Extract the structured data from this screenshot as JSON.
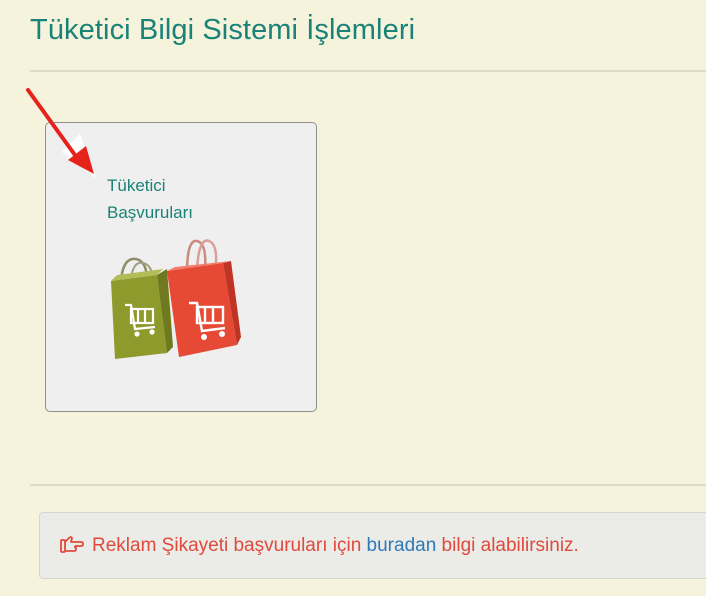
{
  "header": {
    "title": "Tüketici Bilgi Sistemi İşlemleri"
  },
  "tiles": [
    {
      "label_line1": "Tüketici",
      "label_line2": "Başvuruları",
      "image_icon": "shopping-bags-icon"
    }
  ],
  "annotation": {
    "arrow_icon": "red-arrow-icon",
    "arrow_color": "#e5231b"
  },
  "notice": {
    "icon": "hand-pointer-icon",
    "text_before": "Reklam Şikayeti başvuruları için ",
    "link_text": "buradan",
    "text_after": " bilgi alabilirsiniz."
  },
  "colors": {
    "background": "#f5f3dc",
    "title": "#1a8277",
    "notice_text": "#e04a3c",
    "link": "#2d7ab8",
    "bag_green": "#8e9a2c",
    "bag_red": "#e64a35"
  }
}
